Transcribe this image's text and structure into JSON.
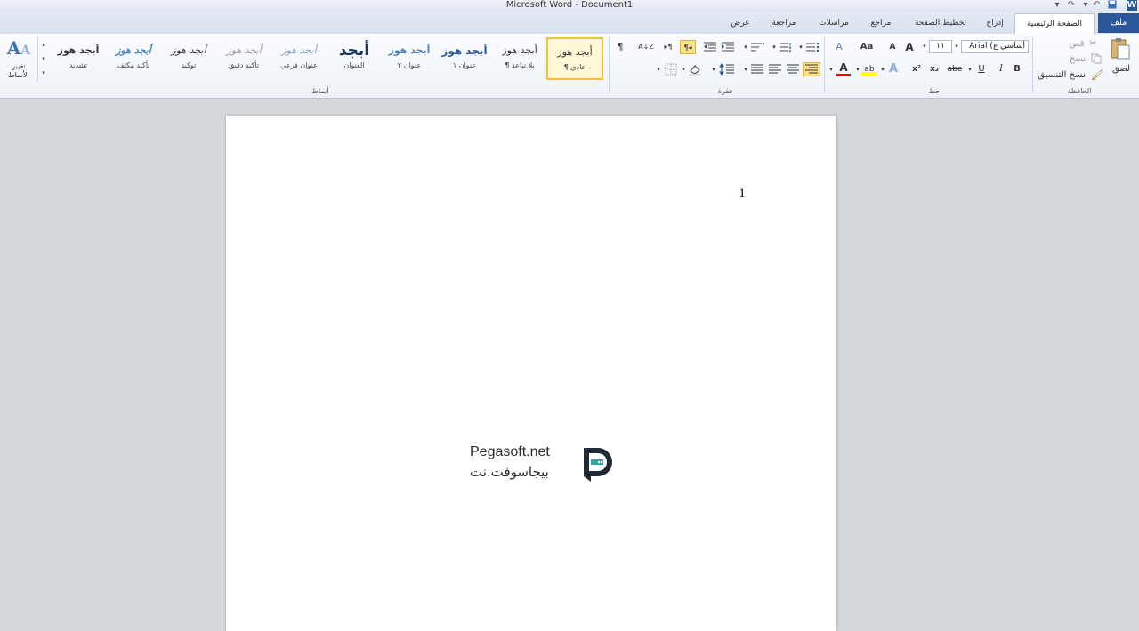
{
  "window": {
    "title": "Microsoft Word - Document1"
  },
  "qat": {
    "word_icon": "W",
    "save_icon": "save",
    "undo_icon": "↶",
    "redo_icon": "↷",
    "customize_icon": "▾"
  },
  "tabs": {
    "file": "ملف",
    "home": "الصفحة الرئيسية",
    "insert": "إدراج",
    "page_layout": "تخطيط الصفحة",
    "references": "مراجع",
    "mailings": "مراسلات",
    "review": "مراجعة",
    "view": "عرض"
  },
  "clipboard": {
    "paste": "لصق",
    "cut": "قص",
    "copy": "نسخ",
    "format_painter": "نسخ التنسيق",
    "label": "الحافظة"
  },
  "font": {
    "font_name": "Arial (أساسي ع",
    "font_size": "١١",
    "grow": "A",
    "shrink": "A",
    "change_case": "Aa",
    "clear": "A",
    "bold": "B",
    "italic": "I",
    "underline": "U",
    "strike": "abe",
    "subscript": "x₂",
    "superscript": "x²",
    "effects": "A",
    "highlight": "ab",
    "font_color": "A",
    "label": "خط"
  },
  "paragraph": {
    "label": "فقرة",
    "pilcrow": "¶",
    "sort": "A↓Z",
    "rtl": "¶◂",
    "ltr": "▸¶"
  },
  "styles": {
    "label": "أنماط",
    "items": [
      {
        "sample": "أبجد هوز",
        "name": "¶ عادي"
      },
      {
        "sample": "أبجد هوز",
        "name": "¶ بلا تباعد"
      },
      {
        "sample": "أبجد هوز",
        "name": "عنوان ١"
      },
      {
        "sample": "أبجد هوز",
        "name": "عنوان ٢"
      },
      {
        "sample": "أبجد",
        "name": "العنوان"
      },
      {
        "sample": "أبجد هوز",
        "name": "عنوان فرعي"
      },
      {
        "sample": "أبجد هوز",
        "name": "تأكيد دقيق"
      },
      {
        "sample": "أبجد هوز",
        "name": "توكيد"
      },
      {
        "sample": "أبجد هوز",
        "name": "تأكيد مكثف"
      },
      {
        "sample": "أبجد هوز",
        "name": "تشديد"
      }
    ],
    "change_styles": "تغيير الأنماط"
  },
  "document": {
    "body_text": "1"
  },
  "watermark": {
    "latin": "Pegasoft.net",
    "arabic": "بيجاسوفت.نت"
  },
  "colors": {
    "file_tab": "#2b579a",
    "highlight": "#ffff00",
    "font_color": "#ff0000",
    "accent_selected": "#f0c040"
  }
}
